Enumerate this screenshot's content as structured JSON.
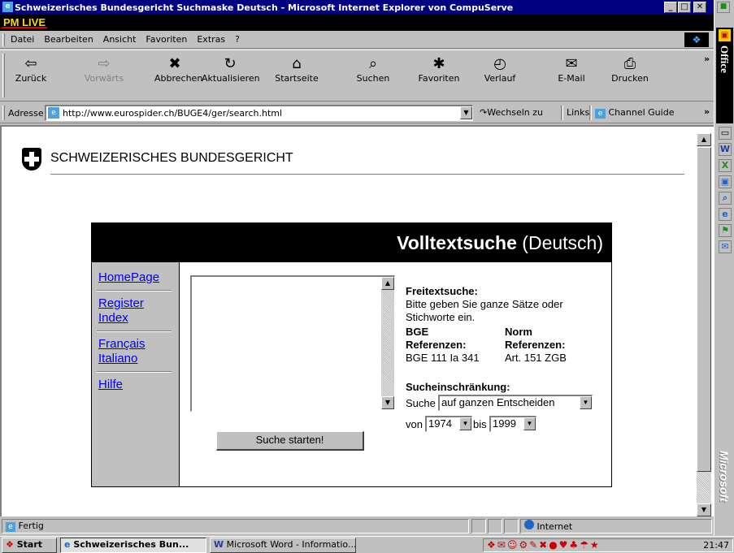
{
  "window": {
    "title": "Schweizerisches Bundesgericht Suchmaske Deutsch - Microsoft Internet Explorer von CompuServe",
    "min": "_",
    "max": "□",
    "close": "✕"
  },
  "brand": {
    "pm_live": "PM LIVE"
  },
  "menu": [
    "Datei",
    "Bearbeiten",
    "Ansicht",
    "Favoriten",
    "Extras",
    "?"
  ],
  "toolbar": [
    {
      "label": "Zurück",
      "icon": "⇦"
    },
    {
      "label": "Vorwärts",
      "icon": "⇨"
    },
    {
      "label": "Abbrechen",
      "icon": "✖"
    },
    {
      "label": "Aktualisieren",
      "icon": "↻"
    },
    {
      "label": "Startseite",
      "icon": "⌂"
    },
    {
      "label": "Suchen",
      "icon": "⌕"
    },
    {
      "label": "Favoriten",
      "icon": "✱"
    },
    {
      "label": "Verlauf",
      "icon": "◴"
    },
    {
      "label": "E-Mail",
      "icon": "✉"
    },
    {
      "label": "Drucken",
      "icon": "⎙"
    }
  ],
  "toolbar_more": "»",
  "address": {
    "label": "Adresse",
    "url": "http://www.eurospider.ch/BUGE4/ger/search.html",
    "go": "Wechseln zu",
    "links": "Links",
    "channel": "Channel Guide"
  },
  "page": {
    "header": "SCHWEIZERISCHES BUNDESGERICHT",
    "banner_bold": "Volltextsuche",
    "banner_rest": " (Deutsch)",
    "nav": [
      "HomePage",
      "Register Index",
      "Français Italiano",
      "Hilfe"
    ],
    "nav_lines": [
      [
        "HomePage"
      ],
      [
        "Register",
        "Index"
      ],
      [
        "Français",
        "Italiano"
      ],
      [
        "Hilfe"
      ]
    ],
    "search_textarea": "",
    "search_button": "Suche starten!",
    "freitext_title": "Freitextsuche:",
    "freitext_desc": "Bitte geben Sie ganze Sätze oder Stichworte ein.",
    "bge_title1": "BGE",
    "bge_title2": "Referenzen:",
    "bge_example": "BGE 111 Ia 341",
    "norm_title1": "Norm",
    "norm_title2": "Referenzen:",
    "norm_example": "Art. 151 ZGB",
    "restrict_title": "Sucheinschränkung:",
    "suche_label": "Suche",
    "suche_select": "auf ganzen Entscheiden",
    "von_label": "von",
    "von_select": "1974",
    "bis_label": "bis",
    "bis_select": "1999"
  },
  "status": {
    "text": "Fertig",
    "zone": "Internet"
  },
  "taskbar": {
    "start": "Start",
    "task1": "Schweizerisches Bun...",
    "task2": "Microsoft Word - Informatio...",
    "clock": "21:47"
  },
  "office_bar": {
    "label": "Office",
    "vertical_text": "Microsoft"
  }
}
